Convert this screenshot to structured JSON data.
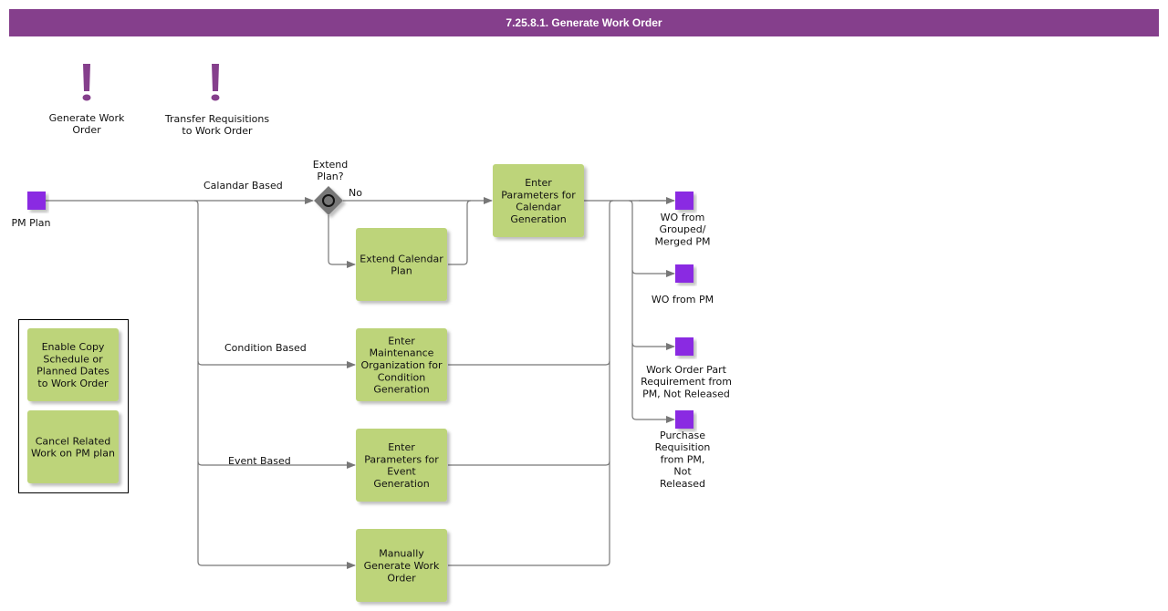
{
  "header": {
    "title": "7.25.8.1. Generate Work Order"
  },
  "colors": {
    "title_bar": "#853f8c",
    "event": "#8a2be2",
    "task": "#bdd47a",
    "gateway": "#777777",
    "alert": "#853f8c",
    "connector": "#777777"
  },
  "alerts": [
    {
      "icon": "exclamation-icon",
      "label_lines": [
        "Generate Work",
        "Order"
      ]
    },
    {
      "icon": "exclamation-icon",
      "label_lines": [
        "Transfer Requisitions",
        "to Work Order"
      ]
    }
  ],
  "start_event": {
    "label": "PM Plan"
  },
  "gateway": {
    "label_lines": [
      "Extend",
      "Plan?"
    ],
    "no_label": "No"
  },
  "flow_labels": {
    "calendar": "Calandar Based",
    "condition": "Condition Based",
    "event": "Event Based"
  },
  "tasks": {
    "extend_calendar": [
      "Extend Calendar",
      "Plan"
    ],
    "calendar_params": [
      "Enter",
      "Parameters for",
      "Calendar",
      "Generation"
    ],
    "maintenance_org": [
      "Enter",
      "Maintenance",
      "Organization for",
      "Condition",
      "Generation"
    ],
    "event_params": [
      "Enter",
      "Parameters for",
      "Event",
      "Generation"
    ],
    "manual": [
      "Manually",
      "Generate Work",
      "Order"
    ]
  },
  "legend_tasks": [
    [
      "Enable Copy",
      "Schedule or",
      "Planned Dates",
      "to Work Order"
    ],
    [
      "Cancel Related",
      "Work on PM plan"
    ]
  ],
  "end_events": [
    [
      "WO from",
      "Grouped/",
      "Merged PM"
    ],
    [
      "WO from PM"
    ],
    [
      "Work Order Part",
      "Requirement from",
      "PM, Not Released"
    ],
    [
      "Purchase",
      "Requisition",
      "from PM,",
      "Not",
      "Released"
    ]
  ]
}
